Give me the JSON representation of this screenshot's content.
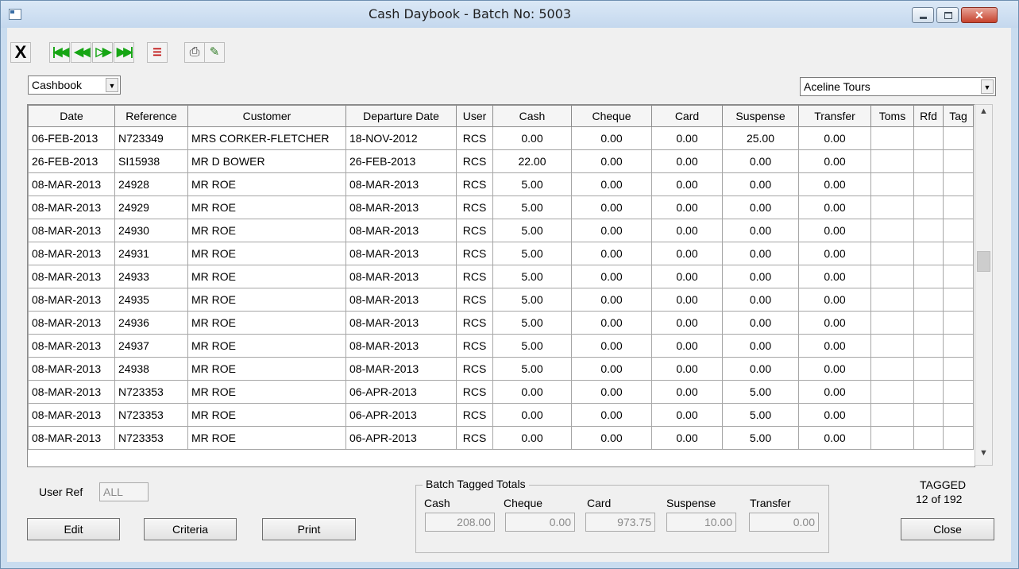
{
  "window": {
    "title": "Cash Daybook - Batch No: 5003"
  },
  "toolbar": {
    "exit_glyph": "X"
  },
  "filters": {
    "book": "Cashbook",
    "company": "Aceline Tours"
  },
  "grid": {
    "columns": [
      "Date",
      "Reference",
      "Customer",
      "Departure Date",
      "User",
      "Cash",
      "Cheque",
      "Card",
      "Suspense",
      "Transfer",
      "Toms",
      "Rfd",
      "Tag"
    ],
    "rows": [
      [
        "06-FEB-2013",
        "N723349",
        "MRS CORKER-FLETCHER",
        "18-NOV-2012",
        "RCS",
        "0.00",
        "0.00",
        "0.00",
        "25.00",
        "0.00",
        "",
        "",
        ""
      ],
      [
        "26-FEB-2013",
        "SI15938",
        "MR D BOWER",
        "26-FEB-2013",
        "RCS",
        "22.00",
        "0.00",
        "0.00",
        "0.00",
        "0.00",
        "",
        "",
        ""
      ],
      [
        "08-MAR-2013",
        "24928",
        "MR ROE",
        "08-MAR-2013",
        "RCS",
        "5.00",
        "0.00",
        "0.00",
        "0.00",
        "0.00",
        "",
        "",
        ""
      ],
      [
        "08-MAR-2013",
        "24929",
        "MR ROE",
        "08-MAR-2013",
        "RCS",
        "5.00",
        "0.00",
        "0.00",
        "0.00",
        "0.00",
        "",
        "",
        ""
      ],
      [
        "08-MAR-2013",
        "24930",
        "MR ROE",
        "08-MAR-2013",
        "RCS",
        "5.00",
        "0.00",
        "0.00",
        "0.00",
        "0.00",
        "",
        "",
        ""
      ],
      [
        "08-MAR-2013",
        "24931",
        "MR ROE",
        "08-MAR-2013",
        "RCS",
        "5.00",
        "0.00",
        "0.00",
        "0.00",
        "0.00",
        "",
        "",
        ""
      ],
      [
        "08-MAR-2013",
        "24933",
        "MR ROE",
        "08-MAR-2013",
        "RCS",
        "5.00",
        "0.00",
        "0.00",
        "0.00",
        "0.00",
        "",
        "",
        ""
      ],
      [
        "08-MAR-2013",
        "24935",
        "MR ROE",
        "08-MAR-2013",
        "RCS",
        "5.00",
        "0.00",
        "0.00",
        "0.00",
        "0.00",
        "",
        "",
        ""
      ],
      [
        "08-MAR-2013",
        "24936",
        "MR ROE",
        "08-MAR-2013",
        "RCS",
        "5.00",
        "0.00",
        "0.00",
        "0.00",
        "0.00",
        "",
        "",
        ""
      ],
      [
        "08-MAR-2013",
        "24937",
        "MR ROE",
        "08-MAR-2013",
        "RCS",
        "5.00",
        "0.00",
        "0.00",
        "0.00",
        "0.00",
        "",
        "",
        ""
      ],
      [
        "08-MAR-2013",
        "24938",
        "MR ROE",
        "08-MAR-2013",
        "RCS",
        "5.00",
        "0.00",
        "0.00",
        "0.00",
        "0.00",
        "",
        "",
        ""
      ],
      [
        "08-MAR-2013",
        "N723353",
        "MR ROE",
        "06-APR-2013",
        "RCS",
        "0.00",
        "0.00",
        "0.00",
        "5.00",
        "0.00",
        "",
        "",
        ""
      ],
      [
        "08-MAR-2013",
        "N723353",
        "MR ROE",
        "06-APR-2013",
        "RCS",
        "0.00",
        "0.00",
        "0.00",
        "5.00",
        "0.00",
        "",
        "",
        ""
      ],
      [
        "08-MAR-2013",
        "N723353",
        "MR ROE",
        "06-APR-2013",
        "RCS",
        "0.00",
        "0.00",
        "0.00",
        "5.00",
        "0.00",
        "",
        "",
        ""
      ]
    ]
  },
  "footer": {
    "user_ref_label": "User Ref",
    "user_ref_value": "ALL",
    "edit_label": "Edit",
    "criteria_label": "Criteria",
    "print_label": "Print",
    "close_label": "Close",
    "tagged_label": "TAGGED",
    "tagged_count": "12 of 192"
  },
  "totals": {
    "title": "Batch Tagged Totals",
    "cash_label": "Cash",
    "cash": "208.00",
    "cheque_label": "Cheque",
    "cheque": "0.00",
    "card_label": "Card",
    "card": "973.75",
    "suspense_label": "Suspense",
    "suspense": "10.00",
    "transfer_label": "Transfer",
    "transfer": "0.00"
  },
  "colors": {
    "title_bar": "#c4d8ee",
    "nav_icon": "#16a514",
    "close_button": "#c7432e"
  },
  "icons": [
    "window-icon",
    "exit-icon",
    "first-record-icon",
    "previous-record-icon",
    "next-record-icon",
    "last-record-icon",
    "form-view-icon",
    "printer-icon",
    "tool-icon"
  ]
}
